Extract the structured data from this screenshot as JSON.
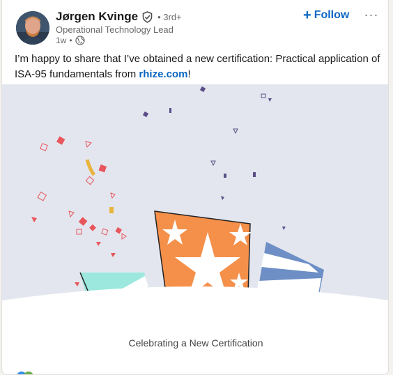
{
  "author": {
    "name": "Jørgen Kvinge",
    "degree": "3rd+",
    "headline": "Operational Technology Lead",
    "time": "1w",
    "avatar_icon": "profile-photo",
    "verified_icon": "verified-shield-icon",
    "visibility_icon": "globe-icon"
  },
  "actions": {
    "follow_label": "Follow",
    "more_label": "···"
  },
  "post": {
    "text_before": "I’m happy to share that I’ve obtained a new certification: Practical application of ISA-95 fundamentals from ",
    "link_text": "rhize.com",
    "text_after": "!"
  },
  "media": {
    "caption": "Celebrating a New Certification",
    "illustration": "confetti-and-gift-boxes"
  },
  "colors": {
    "accent": "#0a66c2",
    "orange_box": "#f5904a",
    "teal_box": "#9ce8de",
    "blue_box": "#6d8fc6",
    "confetti_red": "#e8565c",
    "confetti_purple": "#5a4d87",
    "confetti_yellow": "#e8b43c",
    "media_bg": "#e3e6ee"
  }
}
